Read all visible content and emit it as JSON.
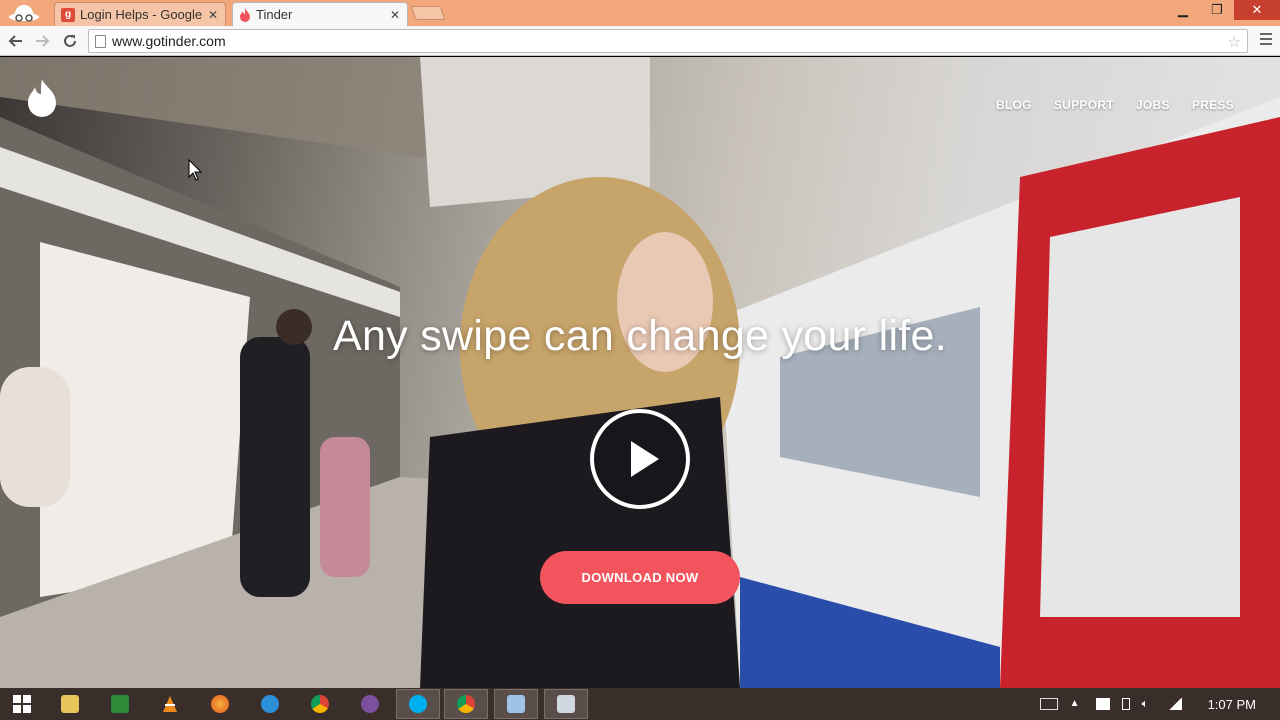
{
  "browser": {
    "tabs": [
      {
        "title": "Login Helps - Google",
        "icon": "google-plus-icon",
        "active": false
      },
      {
        "title": "Tinder",
        "icon": "tinder-flame-icon",
        "active": true
      }
    ],
    "url": "www.gotinder.com"
  },
  "page": {
    "nav": [
      "BLOG",
      "SUPPORT",
      "JOBS",
      "PRESS"
    ],
    "headline": "Any swipe can change your life.",
    "cta": "DOWNLOAD NOW",
    "colors": {
      "accent": "#f1545c",
      "text": "#ffffff"
    }
  },
  "taskbar": {
    "apps": [
      "start-icon",
      "file-explorer-icon",
      "excel-icon",
      "vlc-icon",
      "firefox-icon",
      "ie-icon",
      "chrome-icon",
      "viber-icon",
      "skype-icon",
      "chrome-icon",
      "app-icon",
      "app-icon"
    ],
    "time": "1:07 PM"
  }
}
